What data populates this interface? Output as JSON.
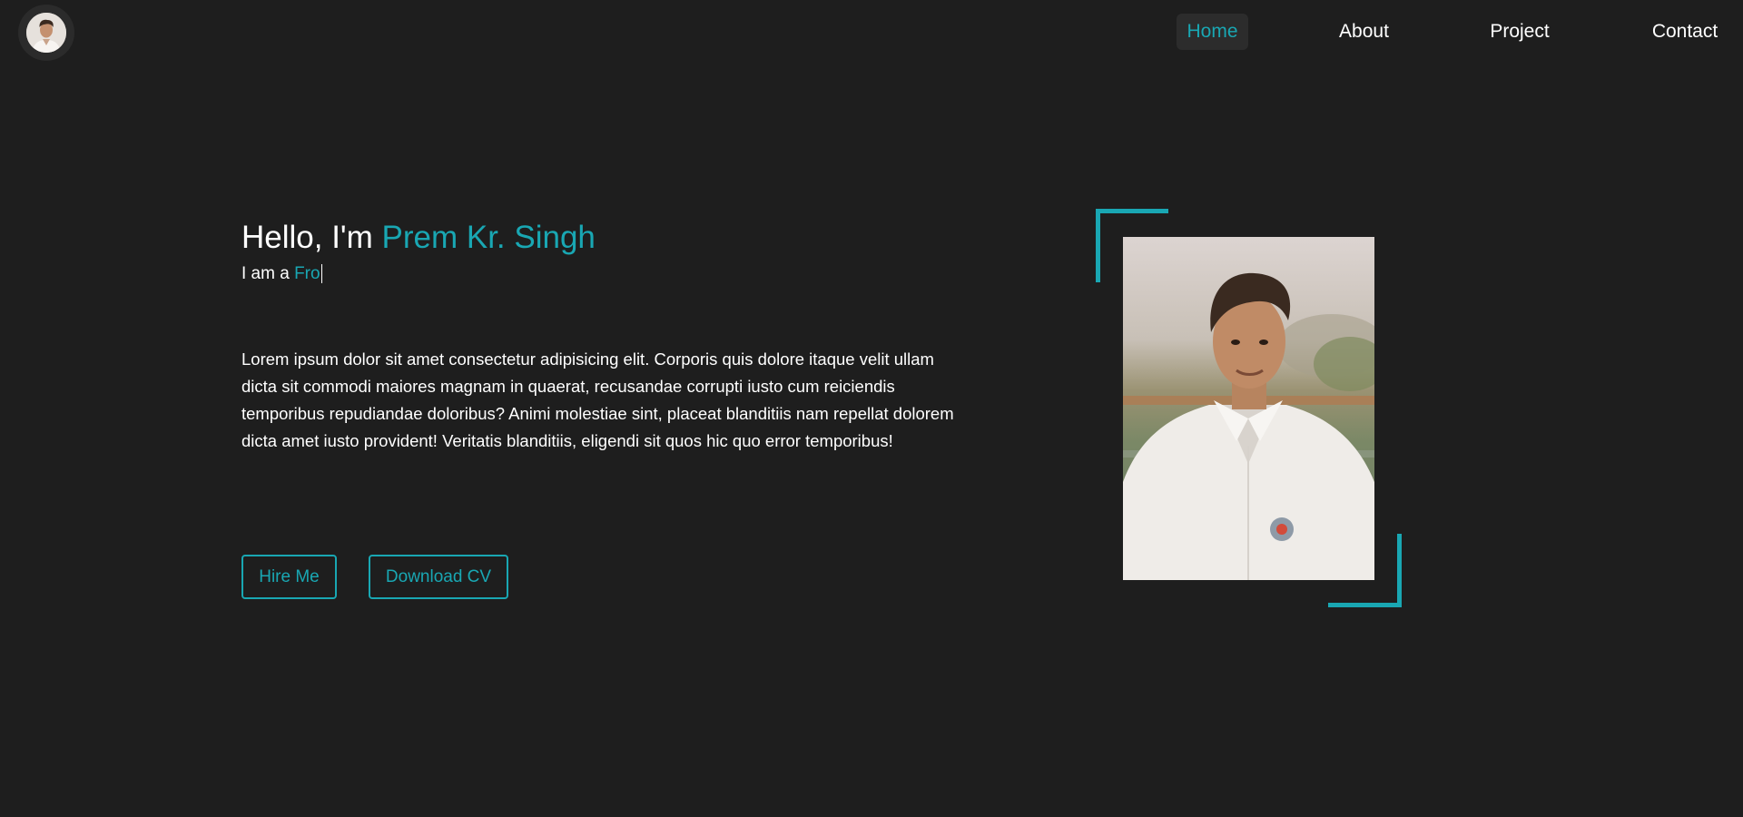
{
  "nav": {
    "logo_icon": "avatar-icon",
    "links": [
      {
        "label": "Home",
        "active": true
      },
      {
        "label": "About",
        "active": false
      },
      {
        "label": "Project",
        "active": false
      },
      {
        "label": "Contact",
        "active": false
      }
    ]
  },
  "hero": {
    "greeting_prefix": "Hello, I'm ",
    "name": "Prem Kr. Singh",
    "role_prefix": "I am a ",
    "role_typed": "Fro",
    "bio": "Lorem ipsum dolor sit amet consectetur adipisicing elit. Corporis quis dolore itaque velit ullam dicta sit commodi maiores magnam in quaerat, recusandae corrupti iusto cum reiciendis temporibus repudiandae doloribus? Animi molestiae sint, placeat blanditiis nam repellat dolorem dicta amet iusto provident! Veritatis blanditiis, eligendi sit quos hic quo error temporibus!",
    "buttons": {
      "hire": "Hire Me",
      "cv": "Download CV"
    },
    "photo": "profile-photo"
  },
  "colors": {
    "accent": "#19a7b3",
    "background": "#1e1e1e",
    "text": "#ffffff"
  }
}
